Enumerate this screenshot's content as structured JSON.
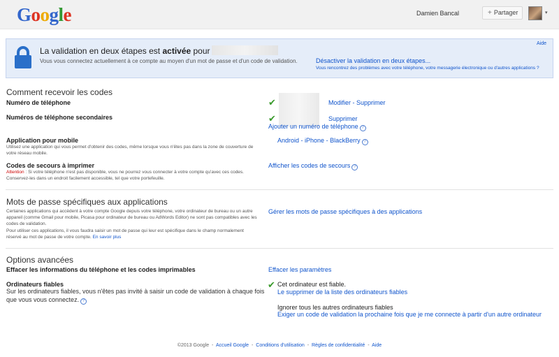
{
  "header": {
    "logo_letters": [
      {
        "ch": "G",
        "color": "#3366cc"
      },
      {
        "ch": "o",
        "color": "#dd3322"
      },
      {
        "ch": "o",
        "color": "#eeaa00"
      },
      {
        "ch": "g",
        "color": "#3366cc"
      },
      {
        "ch": "l",
        "color": "#339933"
      },
      {
        "ch": "e",
        "color": "#dd3322"
      }
    ],
    "user_name": "Damien Bancal",
    "share_label": "Partager",
    "share_plus": "+",
    "avatar_caret": "▾"
  },
  "banner": {
    "title_prefix": "La validation en deux étapes est ",
    "title_status": "activée",
    "title_suffix": " pour",
    "subtitle": "Vous vous connectez actuellement à ce compte au moyen d'un mot de passe et d'un code de validation.",
    "help_label": "Aide",
    "disable_link": "Désactiver la validation en deux étapes...",
    "problems_link": "Vous rencontrez des problèmes avec votre téléphone, votre messagerie électronique ou d'autres applications ?",
    "icon": "lock-icon"
  },
  "codes_section": {
    "title": "Comment recevoir les codes",
    "phone_label": "Numéro de téléphone",
    "phone_actions": {
      "modify": "Modifier",
      "sep": " - ",
      "delete": "Supprimer"
    },
    "secondary_label": "Numéros de téléphone secondaires",
    "secondary_delete": "Supprimer",
    "add_phone": "Ajouter un numéro de téléphone",
    "mobile_label": "Application pour mobile",
    "mobile_desc": "Utilisez une application qui vous permet d'obtenir des codes, même lorsque vous n'êtes pas dans la zone de couverture de votre réseau mobile.",
    "mobile_links": {
      "android": "Android",
      "iphone": "iPhone",
      "blackberry": "BlackBerry",
      "sep": " - "
    },
    "backup_label": "Codes de secours à imprimer",
    "backup_attention": "Attention",
    "backup_desc": " : Si votre téléphone n'est pas disponible, vous ne pourrez vous connecter à votre compte qu'avec ces codes. Conservez-les dans un endroit facilement accessible, tel que votre portefeuille.",
    "backup_link": "Afficher les codes de secours",
    "help_glyph": "?"
  },
  "app_passwords": {
    "title": "Mots de passe spécifiques aux applications",
    "desc1": "Certaines applications qui accèdent à votre compte Google depuis votre téléphone, votre ordinateur de bureau ou un autre appareil (comme Gmail pour mobile, Picasa pour ordinateur de bureau ou AdWords Editor) ne sont pas compatibles avec les codes de validation.",
    "desc2": "Pour utiliser ces applications, il vous faudra saisir un mot de passe qui leur est spécifique dans le champ normalement réservé au mot de passe de votre compte. ",
    "learn_more": "En savoir plus",
    "manage_link": "Gérer les mots de passe spécifiques à des applications"
  },
  "advanced": {
    "title": "Options avancées",
    "erase_label": "Effacer les informations du téléphone et les codes imprimables",
    "erase_link": "Effacer les paramètres",
    "trusted_label": "Ordinateurs fiables",
    "trusted_desc": "Sur les ordinateurs fiables, vous n'êtes pas invité à saisir un code de validation à chaque fois que vous vous connectez.",
    "this_computer": "Cet ordinateur est fiable.",
    "remove_link": "Le supprimer de la liste des ordinateurs fiables",
    "ignore_text": "Ignorer tous les autres ordinateurs fiables",
    "require_link": "Exiger un code de validation la prochaine fois que je me connecte à partir d'un autre ordinateur"
  },
  "footer": {
    "copyright": "©2013 Google",
    "links": [
      "Accueil Google",
      "Conditions d'utilisation",
      "Règles de confidentialité",
      "Aide"
    ],
    "sep": "-"
  },
  "colors": {
    "link": "#1155cc",
    "check": "#3a9a2c",
    "banner_bg": "#e5edf9",
    "attention": "#cc0000"
  }
}
